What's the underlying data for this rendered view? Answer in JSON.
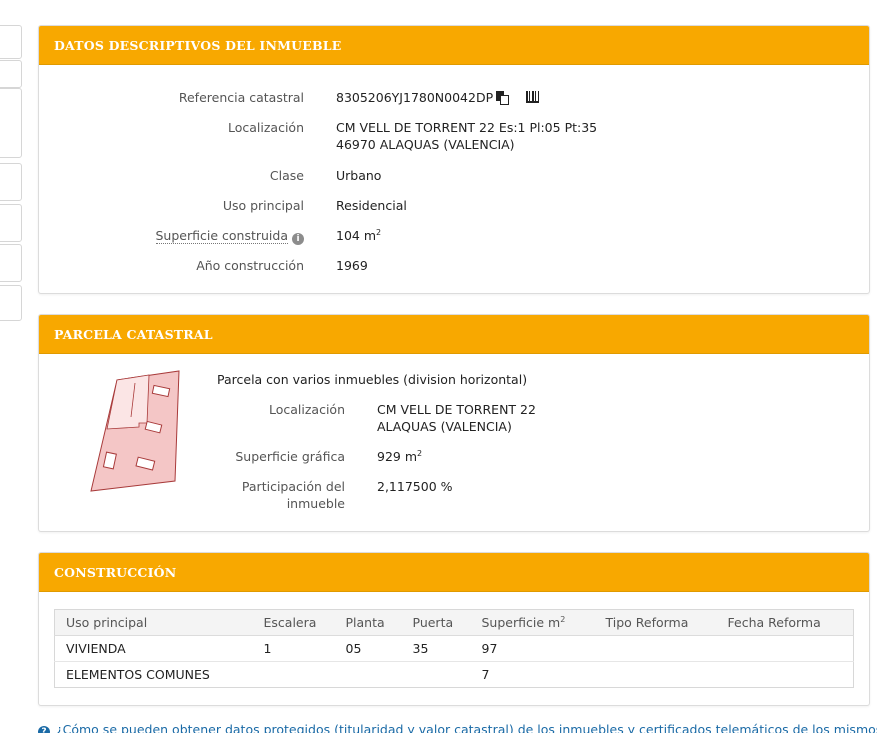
{
  "descriptivos": {
    "header": "DATOS DESCRIPTIVOS DEL INMUEBLE",
    "referencia_label": "Referencia catastral",
    "referencia_value": "8305206YJ1780N0042DP",
    "localizacion_label": "Localización",
    "localizacion_line1": "CM VELL DE TORRENT 22 Es:1 Pl:05 Pt:35",
    "localizacion_line2": "46970 ALAQUAS (VALENCIA)",
    "clase_label": "Clase",
    "clase_value": "Urbano",
    "uso_label": "Uso principal",
    "uso_value": "Residencial",
    "superficie_label": "Superficie construida",
    "superficie_value": "104 m",
    "superficie_unit_exp": "2",
    "anio_label": "Año construcción",
    "anio_value": "1969"
  },
  "parcela": {
    "header": "PARCELA CATASTRAL",
    "title": "Parcela con varios inmuebles (division horizontal)",
    "localizacion_label": "Localización",
    "localizacion_line1": "CM VELL DE TORRENT 22",
    "localizacion_line2": "ALAQUAS (VALENCIA)",
    "superficie_label": "Superficie gráfica",
    "superficie_value": "929 m",
    "superficie_unit_exp": "2",
    "participacion_label_line1": "Participación del",
    "participacion_label_line2": "inmueble",
    "participacion_value": "2,117500 %"
  },
  "construccion": {
    "header": "CONSTRUCCIÓN",
    "columns": [
      "Uso principal",
      "Escalera",
      "Planta",
      "Puerta",
      "Superficie m",
      "Tipo Reforma",
      "Fecha Reforma"
    ],
    "superficie_col_exp": "2",
    "rows": [
      [
        "VIVIENDA",
        "1",
        "05",
        "35",
        "97",
        "",
        ""
      ],
      [
        "ELEMENTOS COMUNES",
        "",
        "",
        "",
        "7",
        "",
        ""
      ]
    ]
  },
  "footer": {
    "link_text": "¿Cómo se pueden obtener datos protegidos (titularidad y valor catastral) de los inmuebles y certificados telemáticos de los mismos?"
  },
  "colors": {
    "header_orange": "#f8a800",
    "parcel_fill": "#f4c6c6",
    "parcel_stroke": "#b03030",
    "link_blue": "#1a6aa6"
  },
  "icons": [
    "copy-icon",
    "barcode-icon",
    "info-icon",
    "question-icon"
  ]
}
